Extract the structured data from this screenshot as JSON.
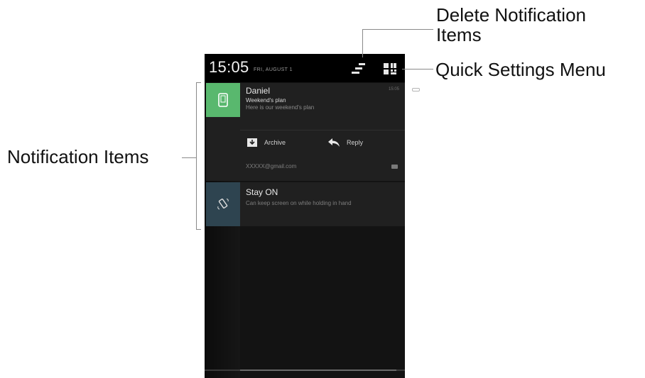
{
  "status_bar": {
    "time": "15:05",
    "date": "FRI, AUGUST 1",
    "clear_icon": "clear-all-icon",
    "quick_settings_icon": "quick-settings-icon"
  },
  "notifications": [
    {
      "app_icon": "phone-icon",
      "title": "Daniel",
      "time": "15:05",
      "subject": "Weekend's plan",
      "preview": "Here is our weekend's plan",
      "actions": [
        {
          "icon": "archive-icon",
          "label": "Archive"
        },
        {
          "icon": "reply-icon",
          "label": "Reply"
        }
      ],
      "account": "XXXXX@gmail.com"
    },
    {
      "app_icon": "rotate-phone-icon",
      "title": "Stay ON",
      "body": "Can keep screen on while holding in hand"
    }
  ],
  "callouts": {
    "delete_line1": "Delete Notification",
    "delete_line2": "Items",
    "quick_settings": "Quick Settings Menu",
    "notification_items": "Notification Items"
  },
  "colors": {
    "screen_bg": "#131313",
    "card_bg": "#202020",
    "mail_icon_bg": "#59b86e",
    "stay_icon_bg": "#2e4450",
    "callout_line": "#8a8a8a"
  }
}
